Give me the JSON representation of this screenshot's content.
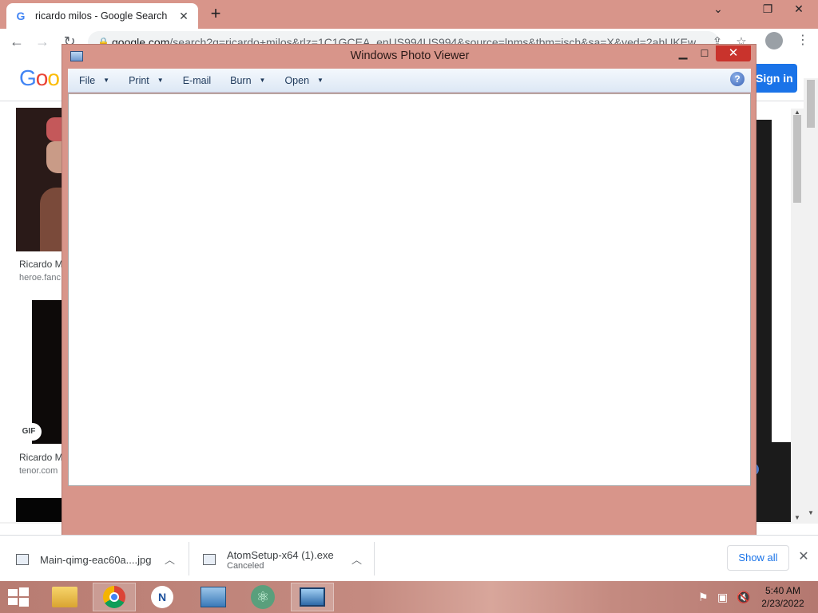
{
  "browser": {
    "tab_title": "ricardo milos - Google Search",
    "tab_favicon": "G",
    "url_host": "google.com",
    "url_rest": "/search?q=ricardo+milos&rlz=1C1GCEA_enUS994US994&source=lnms&tbm=isch&sa=X&ved=2ahUKEw",
    "signin_label": "Sign in"
  },
  "results": [
    {
      "title": "Ricardo M",
      "site": "heroe.fanc"
    },
    {
      "title": "Ricardo M",
      "site": "tenor.com",
      "badge": "GIF"
    }
  ],
  "photo_viewer": {
    "title": "Windows Photo Viewer",
    "menu": [
      {
        "label": "File",
        "has_dropdown": true
      },
      {
        "label": "Print",
        "has_dropdown": true
      },
      {
        "label": "E-mail",
        "has_dropdown": false
      },
      {
        "label": "Burn",
        "has_dropdown": true
      },
      {
        "label": "Open",
        "has_dropdown": true
      }
    ],
    "help_label": "?"
  },
  "downloads": {
    "items": [
      {
        "name": "Main-qimg-eac60a....jpg",
        "status": ""
      },
      {
        "name": "AtomSetup-x64 (1).exe",
        "status": "Canceled"
      }
    ],
    "show_all_label": "Show all"
  },
  "taskbar": {
    "time": "5:40 AM",
    "date": "2/23/2022"
  },
  "colors": {
    "window_frame": "#d8958a",
    "close_red": "#c9332c",
    "google_blue": "#1a73e8"
  }
}
